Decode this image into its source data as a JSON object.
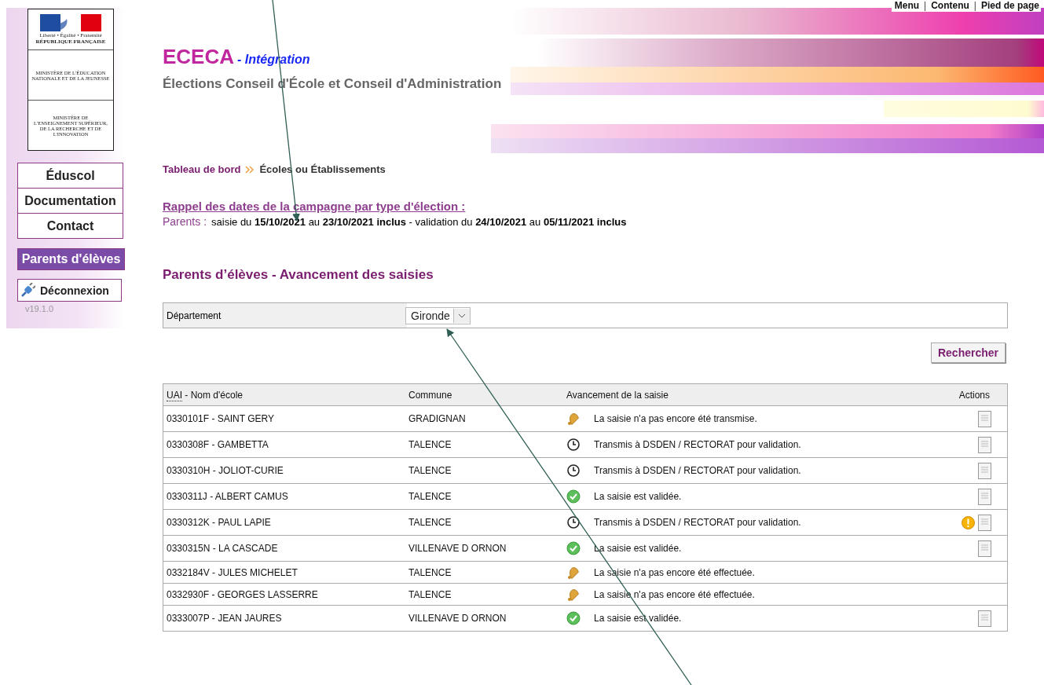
{
  "skip_links": [
    {
      "label": "Menu",
      "kind": "link"
    },
    {
      "label": "|",
      "kind": "separator"
    },
    {
      "label": "Contenu",
      "kind": "link"
    },
    {
      "label": "|",
      "kind": "separator"
    },
    {
      "label": "Pied de page",
      "kind": "link"
    }
  ],
  "logo": {
    "motto": "Liberté • Égalité • Fraternité",
    "republic": "RÉPUBLIQUE FRANÇAISE",
    "ministries": [
      "MINISTÈRE DE L'ÉDUCATION NATIONALE ET DE LA JEUNESSE",
      "MINISTÈRE DE L'ENSEIGNEMENT SUPÉRIEUR, DE LA RECHERCHE ET DE L'INNOVATION"
    ]
  },
  "header": {
    "app_name": "ECECA",
    "environment": "- Intégration",
    "subtitle": "Élections Conseil d'École et Conseil d'Administration"
  },
  "sidebar": {
    "links": [
      {
        "label": "Éduscol"
      },
      {
        "label": "Documentation"
      },
      {
        "label": "Contact"
      }
    ],
    "items": [
      {
        "label": "Parents d'élèves",
        "selected": true
      }
    ],
    "logout": "Déconnexion",
    "version": "v19.1.0"
  },
  "breadcrumb": [
    {
      "label": "Tableau de bord",
      "kind": "link"
    },
    {
      "label": "Écoles ou Établissements",
      "kind": "current"
    }
  ],
  "reminder": {
    "title": "Rappel des dates de la campagne par type d'élection :",
    "label": "Parents :",
    "text": "saisie du **15/10/2021** au **23/10/2021 inclus** - validation du **24/10/2021** au **05/11/2021 inclus**"
  },
  "section_title": "Parents d’élèves - Avancement des saisies",
  "filter": {
    "label": "Département",
    "value": "Gironde"
  },
  "search_button": "Rechercher",
  "table": {
    "columns": [
      "UAI",
      "- Nom d'école",
      "Commune",
      "Avancement de la saisie",
      "Actions"
    ],
    "rows": [
      {
        "school": "0330101F - SAINT GERY",
        "commune": "GRADIGNAN",
        "kind": "pending",
        "progress": "La saisie n'a pas encore été transmise.",
        "warning": false,
        "document": true
      },
      {
        "school": "0330308F - GAMBETTA",
        "commune": "TALENCE",
        "kind": "transmitted",
        "progress": "Transmis à DSDEN / RECTORAT pour validation.",
        "warning": false,
        "document": true
      },
      {
        "school": "0330310H - JOLIOT-CURIE",
        "commune": "TALENCE",
        "kind": "transmitted",
        "progress": "Transmis à DSDEN / RECTORAT pour validation.",
        "warning": false,
        "document": true
      },
      {
        "school": "0330311J - ALBERT CAMUS",
        "commune": "TALENCE",
        "kind": "validated",
        "progress": "La saisie est validée.",
        "warning": false,
        "document": true
      },
      {
        "school": "0330312K - PAUL LAPIE",
        "commune": "TALENCE",
        "kind": "transmitted",
        "progress": "Transmis à DSDEN / RECTORAT pour validation.",
        "warning": true,
        "document": true
      },
      {
        "school": "0330315N - LA CASCADE",
        "commune": "VILLENAVE D ORNON",
        "kind": "validated",
        "progress": "La saisie est validée.",
        "warning": false,
        "document": true
      },
      {
        "school": "0332184V - JULES MICHELET",
        "commune": "TALENCE",
        "kind": "pending",
        "progress": "La saisie n'a pas encore été effectuée.",
        "warning": false,
        "document": false
      },
      {
        "school": "0332930F - GEORGES LASSERRE",
        "commune": "TALENCE",
        "kind": "pending",
        "progress": "La saisie n'a pas encore été effectuée.",
        "warning": false,
        "document": false
      },
      {
        "school": "0333007P - JEAN JAURES",
        "commune": "VILLENAVE D ORNON",
        "kind": "validated",
        "progress": "La saisie est validée.",
        "warning": false,
        "document": true
      }
    ]
  }
}
